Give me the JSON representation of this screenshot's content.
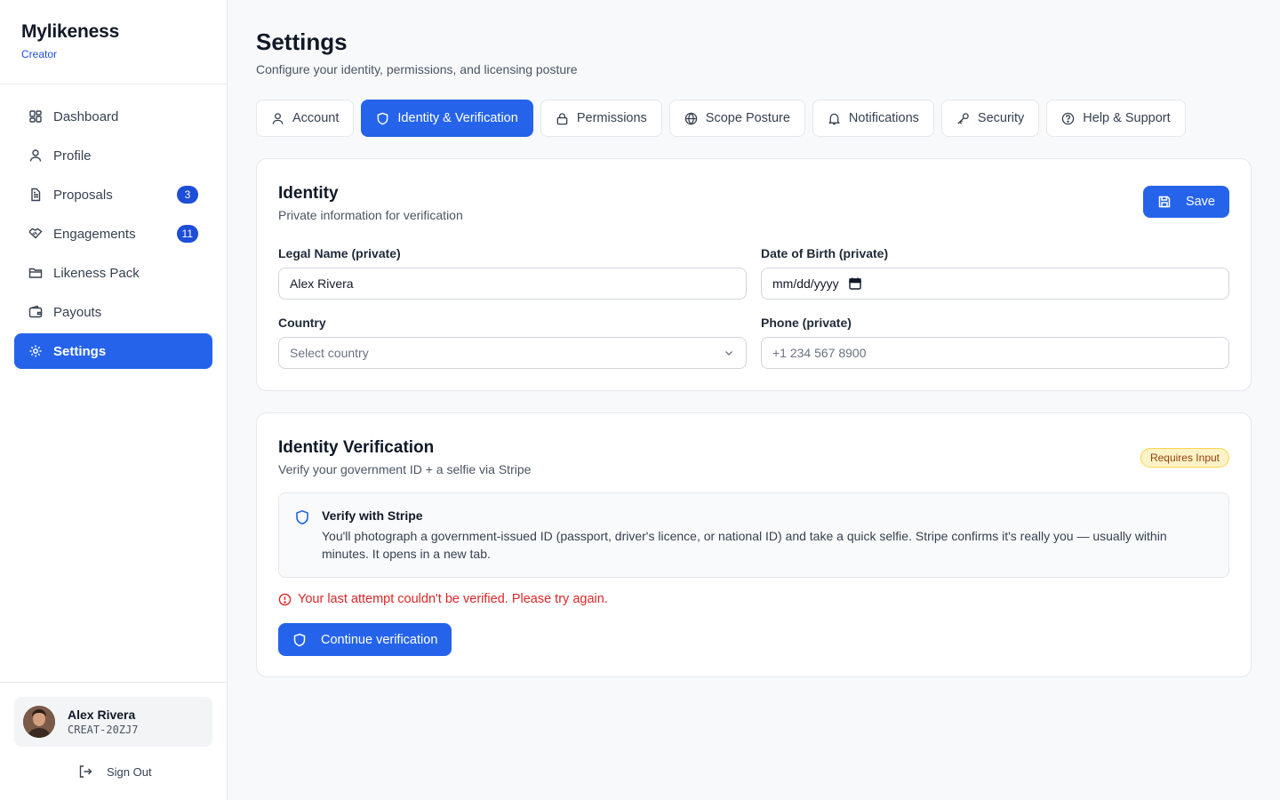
{
  "brand": {
    "name": "Mylikeness",
    "role": "Creator"
  },
  "sidebar": {
    "items": [
      {
        "label": "Dashboard",
        "icon": "dashboard-icon",
        "badge": ""
      },
      {
        "label": "Profile",
        "icon": "user-icon",
        "badge": ""
      },
      {
        "label": "Proposals",
        "icon": "file-icon",
        "badge": "3"
      },
      {
        "label": "Engagements",
        "icon": "handshake-icon",
        "badge": "11"
      },
      {
        "label": "Likeness Pack",
        "icon": "folder-icon",
        "badge": ""
      },
      {
        "label": "Payouts",
        "icon": "wallet-icon",
        "badge": ""
      },
      {
        "label": "Settings",
        "icon": "gear-icon",
        "badge": "",
        "active": true
      }
    ],
    "user": {
      "name": "Alex Rivera",
      "id": "CREAT-20ZJ7"
    },
    "signout_label": "Sign Out"
  },
  "header": {
    "title": "Settings",
    "subtitle": "Configure your identity, permissions, and licensing posture"
  },
  "tabs": [
    {
      "label": "Account",
      "icon": "user-icon"
    },
    {
      "label": "Identity & Verification",
      "icon": "shield-icon",
      "active": true
    },
    {
      "label": "Permissions",
      "icon": "lock-icon"
    },
    {
      "label": "Scope Posture",
      "icon": "globe-icon"
    },
    {
      "label": "Notifications",
      "icon": "bell-icon"
    },
    {
      "label": "Security",
      "icon": "key-icon"
    },
    {
      "label": "Help & Support",
      "icon": "help-icon"
    }
  ],
  "identity": {
    "title": "Identity",
    "subtitle": "Private information for verification",
    "save_label": "Save",
    "legal_name_label": "Legal Name (private)",
    "legal_name_value": "Alex Rivera",
    "dob_label": "Date of Birth (private)",
    "dob_placeholder": "mm/dd/yyyy",
    "country_label": "Country",
    "country_placeholder": "Select country",
    "phone_label": "Phone (private)",
    "phone_placeholder": "+1 234 567 8900"
  },
  "verification": {
    "title": "Identity Verification",
    "subtitle": "Verify your government ID + a selfie via Stripe",
    "status_badge": "Requires Input",
    "info_title": "Verify with Stripe",
    "info_text": "You'll photograph a government-issued ID (passport, driver's licence, or national ID) and take a quick selfie. Stripe confirms it's really you — usually within minutes. It opens in a new tab.",
    "error_text": "Your last attempt couldn't be verified. Please try again.",
    "continue_label": "Continue verification"
  },
  "colors": {
    "accent": "#2563eb",
    "error": "#dc2626",
    "warning_bg": "#fef3c7",
    "warning_text": "#92400e"
  }
}
